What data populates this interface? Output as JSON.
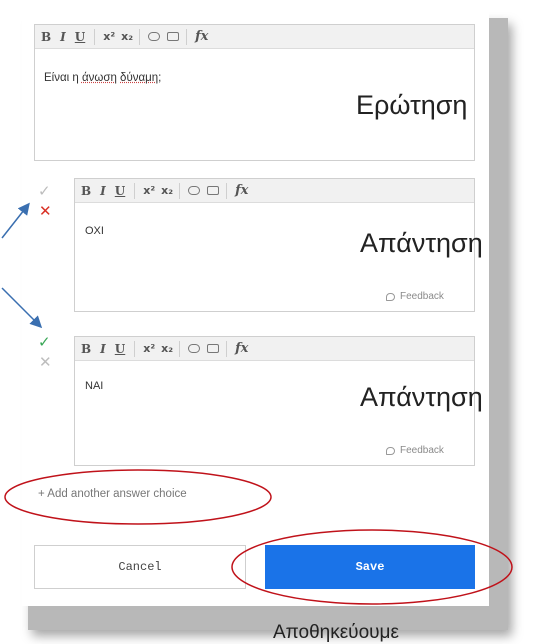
{
  "question": {
    "text_plain": "Είναι η ",
    "text_ul1": "άνωση",
    "text_mid": " ",
    "text_ul2": "δύναμη",
    "text_end": ";",
    "overlay_label": "Ερώτηση"
  },
  "toolbar": {
    "bold": "B",
    "italic": "I",
    "underline": "U",
    "superscript": "x²",
    "subscript": "x₂",
    "formula": "fx"
  },
  "answers": [
    {
      "text": "ΟΧΙ",
      "feedback_label": "Feedback",
      "overlay_label": "Απάντηση",
      "check_mark": "✓",
      "cross_mark": "✕",
      "correct": false
    },
    {
      "text": "ΝΑΙ",
      "feedback_label": "Feedback",
      "overlay_label": "Απάντηση",
      "check_mark": "✓",
      "cross_mark": "✕",
      "correct": true
    }
  ],
  "add_choice_label": "+ Add another answer choice",
  "buttons": {
    "cancel": "Cancel",
    "save": "Save"
  },
  "bottom_caption": "Αποθηκεύουμε",
  "colors": {
    "save_bg": "#1a73e8",
    "correct_green": "#3aa757",
    "wrong_red": "#d93025",
    "annotation_red": "#c0121a",
    "annotation_arrow": "#3a6fb0"
  }
}
